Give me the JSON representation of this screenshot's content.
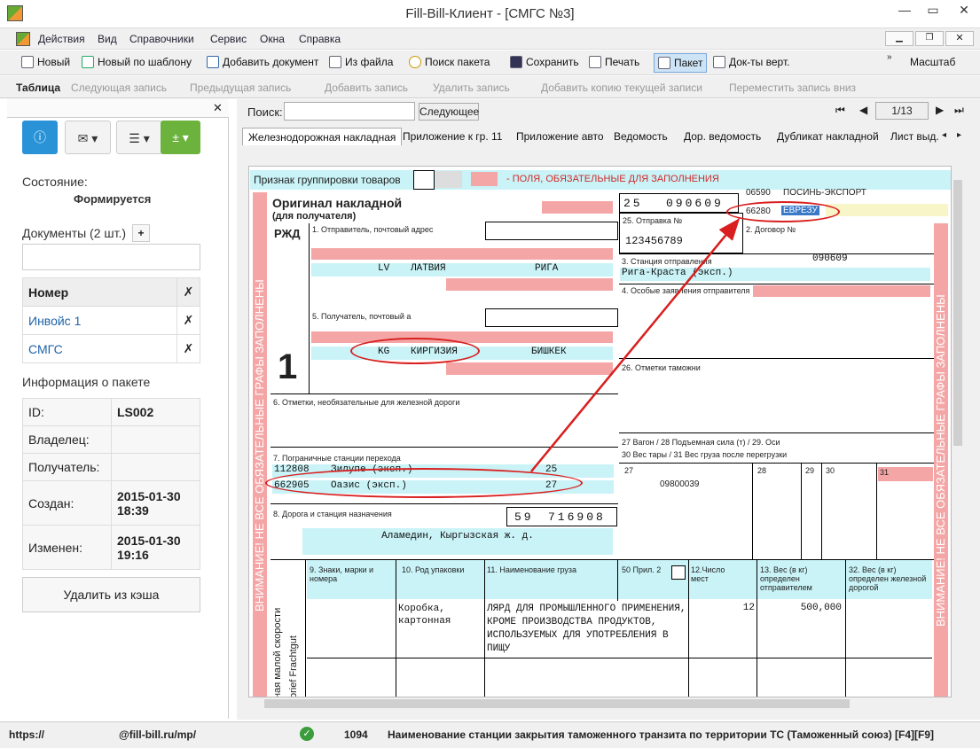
{
  "window": {
    "title": "Fill-Bill-Клиент - [СМГС №3]"
  },
  "menu": [
    "Действия",
    "Вид",
    "Справочники",
    "Сервис",
    "Окна",
    "Справка"
  ],
  "toolbar": {
    "new": "Новый",
    "new_template": "Новый по шаблону",
    "add_doc": "Добавить документ",
    "from_file": "Из файла",
    "search_pack": "Поиск пакета",
    "save": "Сохранить",
    "print": "Печать",
    "pack": "Пакет",
    "docs_vert": "Док-ты верт.",
    "scale": "Масштаб"
  },
  "table_toolbar": {
    "table": "Таблица",
    "next": "Следующая запись",
    "prev": "Предыдущая запись",
    "add": "Добавить запись",
    "delete": "Удалить запись",
    "copy": "Добавить копию текущей записи",
    "move": "Переместить запись вниз"
  },
  "left": {
    "state_label": "Состояние:",
    "state_value": "Формируется",
    "docs_label": "Документы (2 шт.)",
    "col_number": "Номер",
    "docs": [
      "Инвойс 1",
      "СМГС"
    ],
    "info_label": "Информация о пакете",
    "info": [
      {
        "k": "ID:",
        "v": "LS002"
      },
      {
        "k": "Владелец:",
        "v": ""
      },
      {
        "k": "Получатель:",
        "v": ""
      },
      {
        "k": "Создан:",
        "v": "2015-01-30 18:39"
      },
      {
        "k": "Изменен:",
        "v": "2015-01-30 19:16"
      }
    ],
    "delete_cache": "Удалить из кэша"
  },
  "search": {
    "label": "Поиск:",
    "value": "",
    "next": "Следующее",
    "page": "1/13"
  },
  "tabs": [
    "Железнодорожная накладная",
    "Приложение к гр. 11",
    "Приложение авто",
    "Ведомость",
    "Дор. ведомость",
    "Дубликат накладной",
    "Лист выд. г"
  ],
  "form": {
    "group_label": "Признак группировки товаров",
    "required_note": "- ПОЛЯ, ОБЯЗАТЕЛЬНЫЕ ДЛЯ ЗАПОЛНЕНИЯ",
    "original": "Оригинал накладной",
    "for_receiver": "(для получателя)",
    "rzd": "РЖД",
    "big_one": "1",
    "f1": "1. Отправитель, почтовый адрес",
    "sender_country_code": "LV",
    "sender_country": "ЛАТВИЯ",
    "sender_city": "РИГА",
    "f5": "5. Получатель, почтовый а",
    "recv_country_code": "KG",
    "recv_country": "КИРГИЗИЯ",
    "recv_city": "БИШКЕК",
    "f6": "6. Отметки, необязательные для железной дороги",
    "f7": "7. Пограничные станции перехода",
    "border1_code": "112808",
    "border1_name": "Зилупе (эксп.)",
    "border1_num": "25",
    "border2_code": "662905",
    "border2_name": "Оазис (эксп.)",
    "border2_num": "27",
    "f8": "8. Дорога и станция назначения",
    "dest_road": "59",
    "dest_code": "716908",
    "dest_name": "Аламедин, Кыргызская ж. д.",
    "top_num1": "25",
    "top_num2": "090609",
    "exp_code": "06590",
    "exp_name": "ПОСИНЬ-ЭКСПОРТ",
    "rw_code": "66280",
    "rw_name": "ЕВРЕЗУ",
    "f25": "25. Отправка №",
    "shipment_no": "123456789",
    "f2": "2. Договор №",
    "f3": "3. Станция отправления",
    "dep_code": "090609",
    "dep_name": "Рига-Краста (эксп.)",
    "f4": "4. Особые заявления отправителя",
    "f26": "26. Отметки таможни",
    "f27": "27 Вагон / 28 Подъемная сила (т) / 29. Оси",
    "f30": "30 Вес тары / 31 Вес груза после перегрузки",
    "col27": "27",
    "col28": "28",
    "col29": "29",
    "col30": "30",
    "col31": "31",
    "wagon": "09800039",
    "f9": "9. Знаки, марки и номера",
    "f10": "10. Род упаковки",
    "f11": "11. Наименование груза",
    "f50": "50 Прил. 2",
    "f12": "12.Число мест",
    "f13": "13. Вес (в кг) определен отправителем",
    "f32": "32. Вес (в кг) определен железной дорогой",
    "packing": "Коробка, картонная",
    "cargo": "ЛЯРД ДЛЯ ПРОМЫШЛЕННОГО ПРИМЕНЕНИЯ, КРОМЕ ПРОИЗВОДСТВА ПРОДУКТОВ, ИСПОЛЬЗУЕМЫХ ДЛЯ УПОТРЕБЛЕНИЯ В ПИЩУ",
    "places": "12",
    "weight": "500,000",
    "side_warning": "ВНИМАНИЕ! НЕ ВСЕ ОБЯЗАТЕЛЬНЫЕ ГРАФЫ ЗАПОЛНЕНЫ",
    "side_text1": "ная малой скорости",
    "side_text2": "brief Frachtgut"
  },
  "status": {
    "url1": "https://",
    "url2": "@fill-bill.ru/mp/",
    "code": "1094",
    "message": "Наименование станции закрытия таможенного транзита по территории ТС (Таможенный союз) [F4][F9]"
  }
}
